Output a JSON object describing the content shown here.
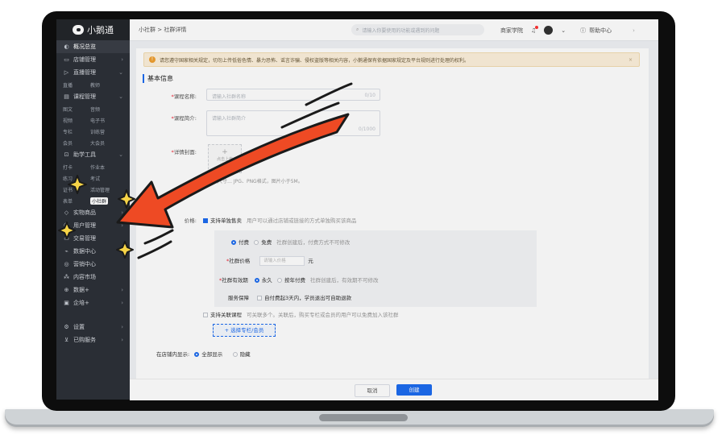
{
  "sidebar": {
    "logo": "小鹅通",
    "items": [
      {
        "label": "概况总览",
        "icon": "overview-icon"
      },
      {
        "label": "店铺管理",
        "icon": "store-icon"
      },
      {
        "label": "直播管理",
        "icon": "live-icon"
      },
      {
        "label": "课程管理",
        "icon": "course-icon"
      },
      {
        "label": "助学工具",
        "icon": "tools-icon"
      },
      {
        "label": "实物商品",
        "icon": "goods-icon"
      },
      {
        "label": "用户管理",
        "icon": "user-icon"
      },
      {
        "label": "交易管理",
        "icon": "trade-icon"
      },
      {
        "label": "数据中心",
        "icon": "data-icon"
      },
      {
        "label": "营销中心",
        "icon": "marketing-icon"
      },
      {
        "label": "内容市场",
        "icon": "market-icon"
      },
      {
        "label": "数据+",
        "icon": "dataplus-icon"
      },
      {
        "label": "企培+",
        "icon": "enterprise-icon"
      },
      {
        "label": "设置",
        "icon": "settings-icon"
      },
      {
        "label": "已购服务",
        "icon": "cart-icon"
      }
    ],
    "live_sub": [
      "直播",
      "教师"
    ],
    "course_sub": [
      [
        "图文",
        "音频"
      ],
      [
        "视频",
        "电子书"
      ],
      [
        "专栏",
        "训练营"
      ],
      [
        "会员",
        "大会员"
      ]
    ],
    "tools_sub": [
      [
        "打卡",
        "作业本"
      ],
      [
        "练习",
        "考试"
      ],
      [
        "证书",
        "活动管理"
      ],
      [
        "表单",
        "小社群"
      ]
    ]
  },
  "topbar": {
    "breadcrumb": "小社群 > 社群详情",
    "search_placeholder": "请输入你要使用的功能或遇到的问题",
    "academy": "商家学院",
    "help": "帮助中心"
  },
  "notice": "请您遵守国家相关规定，切勿上传低俗色情、暴力恐怖、谣言诈骗、侵权盗版等相关内容，小鹅通保有依据国家规定及平台规则进行处理的权利。",
  "form": {
    "section_title": "基本信息",
    "name_label": "课程名称:",
    "name_placeholder": "请输入社群名称",
    "name_count": "0/10",
    "intro_label": "课程简介:",
    "intro_placeholder": "请输入社群简介",
    "intro_count": "0/1000",
    "cover_label": "详情封面:",
    "upload_text": "点击上传",
    "cover_hint": "建议尺寸… JPG、PNG格式，图片小于5M。",
    "sale_label": "价格:",
    "sale_option": "支持单独售卖",
    "sale_desc": "用户可以通过店铺或链接的方式单独购买该商品",
    "pay_paid": "付费",
    "pay_free": "免费",
    "pay_desc": "社群创建后，付费方式不可修改",
    "price_label": "社群价格",
    "price_placeholder": "请输入价格",
    "price_unit": "元",
    "valid_label": "社群有效期",
    "valid_forever": "永久",
    "valid_year": "按年付费",
    "valid_desc": "社群创建后，有效期不可修改",
    "guarantee_label": "服务保障",
    "guarantee_option": "自付费起3天内，学员退出可自助退款",
    "link_option": "支持关联课程",
    "link_desc": "可关联多个。关联后，购买专栏或会员的用户可以免费加入该社群",
    "select_btn": "+ 选择专栏/会员",
    "display_label": "在店铺内显示:",
    "display_all": "全部显示",
    "display_hide": "隐藏"
  },
  "footer": {
    "cancel": "取消",
    "create": "创建"
  },
  "colors": {
    "accent": "#1d6cf0",
    "arrow": "#ee4a24",
    "sidebar": "#2d3138"
  }
}
